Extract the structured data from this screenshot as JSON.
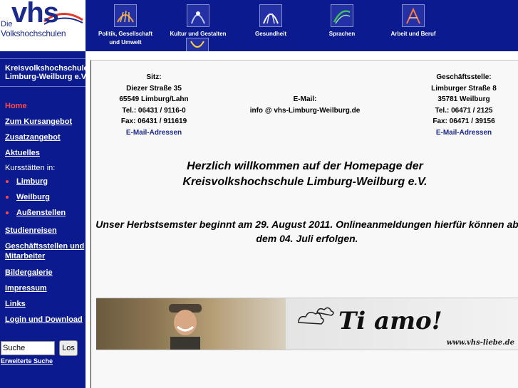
{
  "logo": {
    "die": "Die",
    "vhs": "vhs",
    "subtitle": "Volkshochschulen"
  },
  "nav": [
    {
      "label_line1": "Politik, Gesellschaft",
      "label_line2": "und Umwelt",
      "icon": "politik-icon"
    },
    {
      "label_line1": "Kultur und Gestalten",
      "label_line2": "",
      "icon": "kultur-icon"
    },
    {
      "label_line1": "Gesundheit",
      "label_line2": "",
      "icon": "gesundheit-icon"
    },
    {
      "label_line1": "Sprachen",
      "label_line2": "",
      "icon": "sprachen-icon"
    },
    {
      "label_line1": "Arbeit und Beruf",
      "label_line2": "",
      "icon": "arbeit-icon"
    }
  ],
  "sidebar": {
    "org_line1": "Kreisvolkshochschule",
    "org_line2": "Limburg-Weilburg e.V.",
    "home": "Home",
    "kursangebot": "Zum Kursangebot",
    "zusatzangebot": "Zusatzangebot",
    "aktuelles": "Aktuelles",
    "kursstaetten": "Kursstätten in:",
    "limburg": "Limburg",
    "weilburg": "Weilburg",
    "aussenstellen": "Außenstellen",
    "studienreisen": "Studienreisen",
    "geschaeftsstellen_1": "Geschäftsstellen und",
    "geschaeftsstellen_2": "Mitarbeiter",
    "bildergalerie": "Bildergalerie",
    "impressum": "Impressum",
    "links": "Links",
    "login": "Login und Download",
    "search_value": "Suche",
    "search_button": "Los",
    "advanced_search": "Erweiterte Suche"
  },
  "address_left": {
    "heading": "Sitz:",
    "street": "Diezer Straße 35",
    "city": "65549 Limburg/Lahn",
    "tel": "Tel.: 06431 / 9116-0",
    "fax": "Fax: 06431 / 911619",
    "mail": "E-Mail-Adressen"
  },
  "address_center": {
    "heading": "E-Mail:",
    "email": "info @ vhs-Limburg-Weilburg.de"
  },
  "address_right": {
    "heading": "Geschäftsstelle:",
    "street": "Limburger Straße 8",
    "city": "35781 Weilburg",
    "tel": "Tel.: 06471 / 2125",
    "fax": "Fax: 06471 / 39156",
    "mail": "E-Mail-Adressen"
  },
  "welcome": {
    "line1": "Herzlich willkommen auf der Homepage der",
    "line2": "Kreisvolkshochschule Limburg-Weilburg e.V."
  },
  "notice": {
    "line1": "Unser Herbstsemster beginnt am 29. August 2011. Onlineanmeldungen hierfür können ab",
    "line2": "dem 04. Juli erfolgen."
  },
  "banner": {
    "title": "Ti amo!",
    "url": "www.vhs-liebe.de"
  },
  "colors": {
    "navy": "#0b1b8f",
    "home_red": "#ff4a4a",
    "link_blue": "#1c2a8c"
  }
}
